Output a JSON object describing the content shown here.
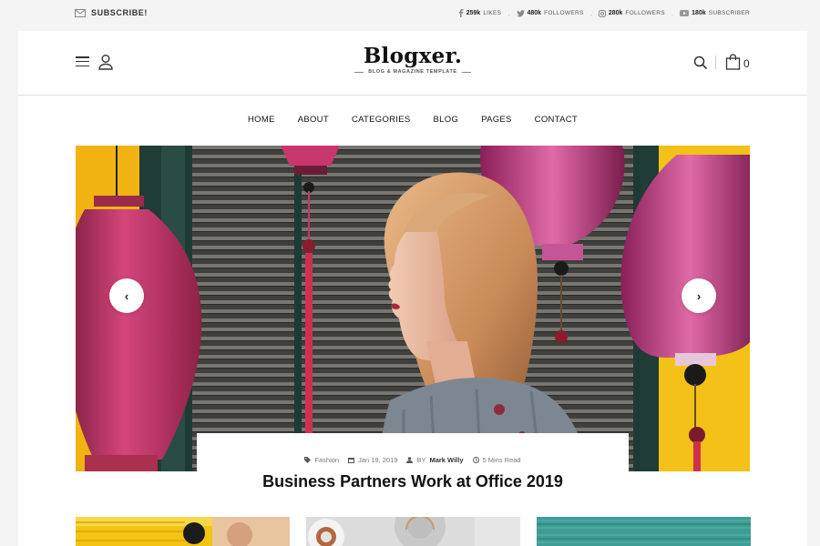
{
  "topbar": {
    "subscribe": "SUBSCRIBE!",
    "social": [
      {
        "icon": "facebook-icon",
        "count": "259k",
        "label": "LIKES"
      },
      {
        "icon": "twitter-icon",
        "count": "480k",
        "label": "FOLLOWERS"
      },
      {
        "icon": "instagram-icon",
        "count": "280k",
        "label": "FOLLOWERS"
      },
      {
        "icon": "youtube-icon",
        "count": "180k",
        "label": "SUBSCRIBER"
      }
    ],
    "separator": "."
  },
  "header": {
    "logo": "Blogxer.",
    "tagline": "BLOG & MAGAZINE TEMPLATE",
    "cart_count": "0"
  },
  "nav": [
    "HOME",
    "ABOUT",
    "CATEGORIES",
    "BLOG",
    "PAGES",
    "CONTACT"
  ],
  "hero": {
    "category": "Fashion",
    "date": "Jan 19, 2019",
    "by": "BY",
    "author": "Mark Willy",
    "read_time": "5 Mins Read",
    "title": "Business Partners Work at Office 2019",
    "prev_arrow": "‹",
    "next_arrow": "›"
  },
  "colors": {
    "accent_yellow": "#f3b10a",
    "lantern_pink": "#c8366e",
    "teal": "#2c5a52"
  }
}
